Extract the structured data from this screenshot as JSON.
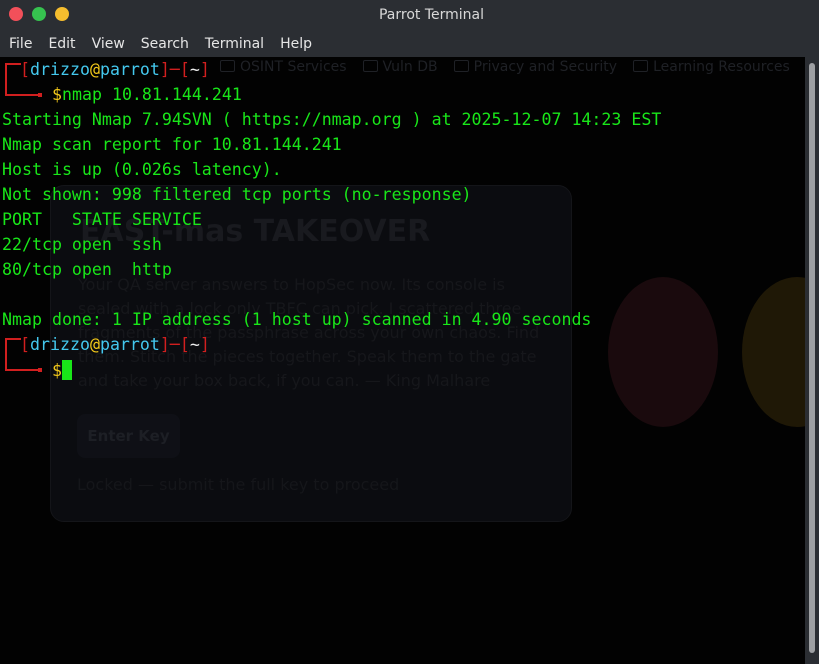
{
  "window": {
    "title": "Parrot Terminal"
  },
  "menu": [
    "File",
    "Edit",
    "View",
    "Search",
    "Terminal",
    "Help"
  ],
  "terminal": {
    "user": "drizzo",
    "at": "@",
    "host": "parrot",
    "cwd": "~",
    "command": "nmap 10.81.144.241",
    "output": [
      "Starting Nmap 7.94SVN ( https://nmap.org ) at 2025-12-07 14:23 EST",
      "Nmap scan report for 10.81.144.241",
      "Host is up (0.026s latency).",
      "Not shown: 998 filtered tcp ports (no-response)",
      "PORT   STATE SERVICE",
      "22/tcp open  ssh",
      "80/tcp open  http",
      "",
      "Nmap done: 1 IP address (1 host up) scanned in 4.90 seconds"
    ],
    "prompt_symbol": "$"
  },
  "background_page": {
    "bookmarks": [
      "OSINT Services",
      "Vuln DB",
      "Privacy and Security",
      "Learning Resources"
    ],
    "card_title": "EAST-mas TAKEOVER",
    "card_text": "Your QA server answers to HopSec now. Its console is sealed with a lock only TBFC can pick. I scattered three fragments of the passphrase across your own chaos. Find them. Stitch the pieces together. Speak them to the gate and take your box back, if you can. — King Malhare",
    "button": "Enter Key",
    "status": "Locked — submit the full key to proceed"
  },
  "colors": {
    "prompt_bracket": "#d11f1f",
    "user": "#44c8ee",
    "host": "#44c8ee",
    "dollar": "#f2c81a",
    "output": "#19e619"
  }
}
